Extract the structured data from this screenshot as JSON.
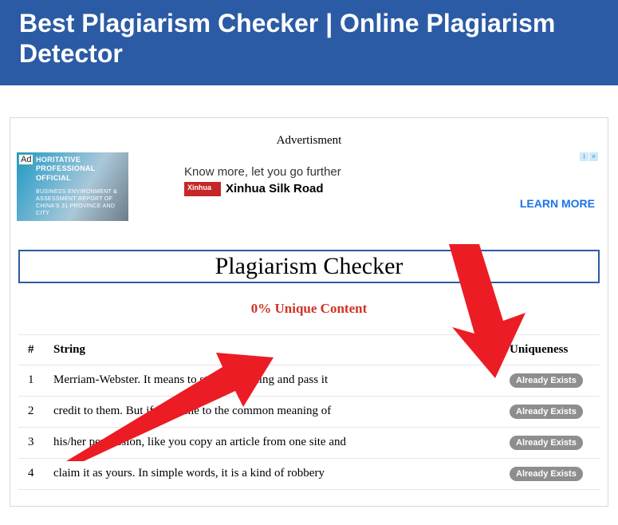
{
  "header": {
    "title": "Best Plagiarism Checker | Online Plagiarism Detector"
  },
  "ad": {
    "label": "Advertisment",
    "badge": "Ad",
    "img_top": "HORITATIVE PROFESSIONAL OFFICIAL",
    "img_small": "BUSINESS ENVIRONMENT & ASSESSMENT REPORT OF CHINA'S 31 PROVINCE AND CITY",
    "tagline": "Know more, let you go further",
    "brand": "Xinhua Silk Road",
    "learn": "LEARN MORE",
    "info": "i",
    "close": "×"
  },
  "box_title": "Plagiarism Checker",
  "unique_line": "0% Unique Content",
  "table": {
    "headers": {
      "num": "#",
      "string": "String",
      "unique": "Uniqueness"
    },
    "exists_label": "Already Exists",
    "rows": [
      {
        "n": "1",
        "s": "Merriam-Webster. It means to steal something and pass it"
      },
      {
        "n": "2",
        "s": "credit to them. But if we come to the common meaning of"
      },
      {
        "n": "3",
        "s": "his/her permission, like you copy an article from one site and"
      },
      {
        "n": "4",
        "s": "claim it as yours. In simple words, it is a kind of robbery"
      }
    ]
  }
}
